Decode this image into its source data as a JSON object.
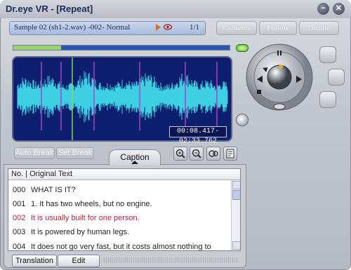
{
  "window": {
    "title": "Dr.eye VR - [Repeat]",
    "minimize_icon": "minimize-icon",
    "close_icon": "close-icon"
  },
  "infobar": {
    "file_label": "Sample 02 (sh1-2.wav) -002-  Normal",
    "page": "1/1",
    "icons": [
      "play-icon",
      "eye-icon"
    ]
  },
  "top_buttons": {
    "contents": "Contents",
    "follow": "Follow",
    "dictate": "Dictate"
  },
  "player": {
    "progress_fraction": 0.22,
    "time": "00:08.417-02:33.762",
    "auto_break": "Auto Break",
    "set_break": "Set Break"
  },
  "tools": [
    "zoom-in-icon",
    "zoom-out-icon",
    "listen-icon",
    "document-icon"
  ],
  "caption_tab": {
    "label": "Caption"
  },
  "caption_list": {
    "header": "No. | Original Text",
    "rows": [
      {
        "no": "000",
        "text": "WHAT IS IT?"
      },
      {
        "no": "001",
        "text": "1. It has two wheels, but no engine."
      },
      {
        "no": "002",
        "text": "It is usually built for one person."
      },
      {
        "no": "003",
        "text": "It is powered by human legs."
      },
      {
        "no": "004",
        "text": "It does not go very fast, but it costs almost nothing to"
      }
    ],
    "selected_index": 2
  },
  "bottom_buttons": {
    "translation": "Translation",
    "edit": "Edit"
  },
  "colors": {
    "wave_bg": "#0e1f6f",
    "wave": "#3ed0e2",
    "marker": "#a844c9",
    "cursor": "#86d45a",
    "highlight": "#a5263b"
  }
}
